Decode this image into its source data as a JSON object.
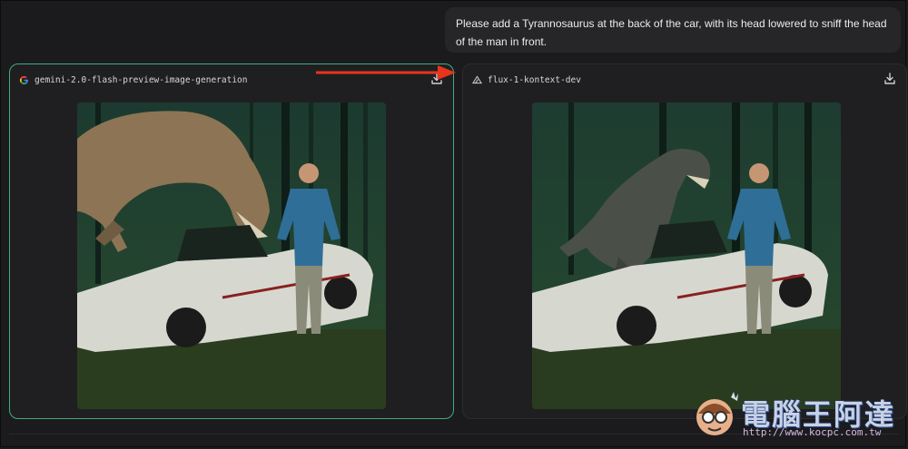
{
  "prompt": {
    "text": "Please add a Tyrannosaurus at the back of the car, with its head lowered to sniff the head of the man in front."
  },
  "panels": [
    {
      "model": "gemini-2.0-flash-preview-image-generation",
      "icon": "google-g-icon",
      "selected": true
    },
    {
      "model": "flux-1-kontext-dev",
      "icon": "flux-triangle-icon",
      "selected": false
    }
  ],
  "watermark": {
    "title": "電腦王阿達",
    "url": "http://www.kocpc.com.tw"
  },
  "colors": {
    "selected_border": "#3fae7a",
    "arrow": "#e8341c",
    "background": "#1b1b1d"
  }
}
